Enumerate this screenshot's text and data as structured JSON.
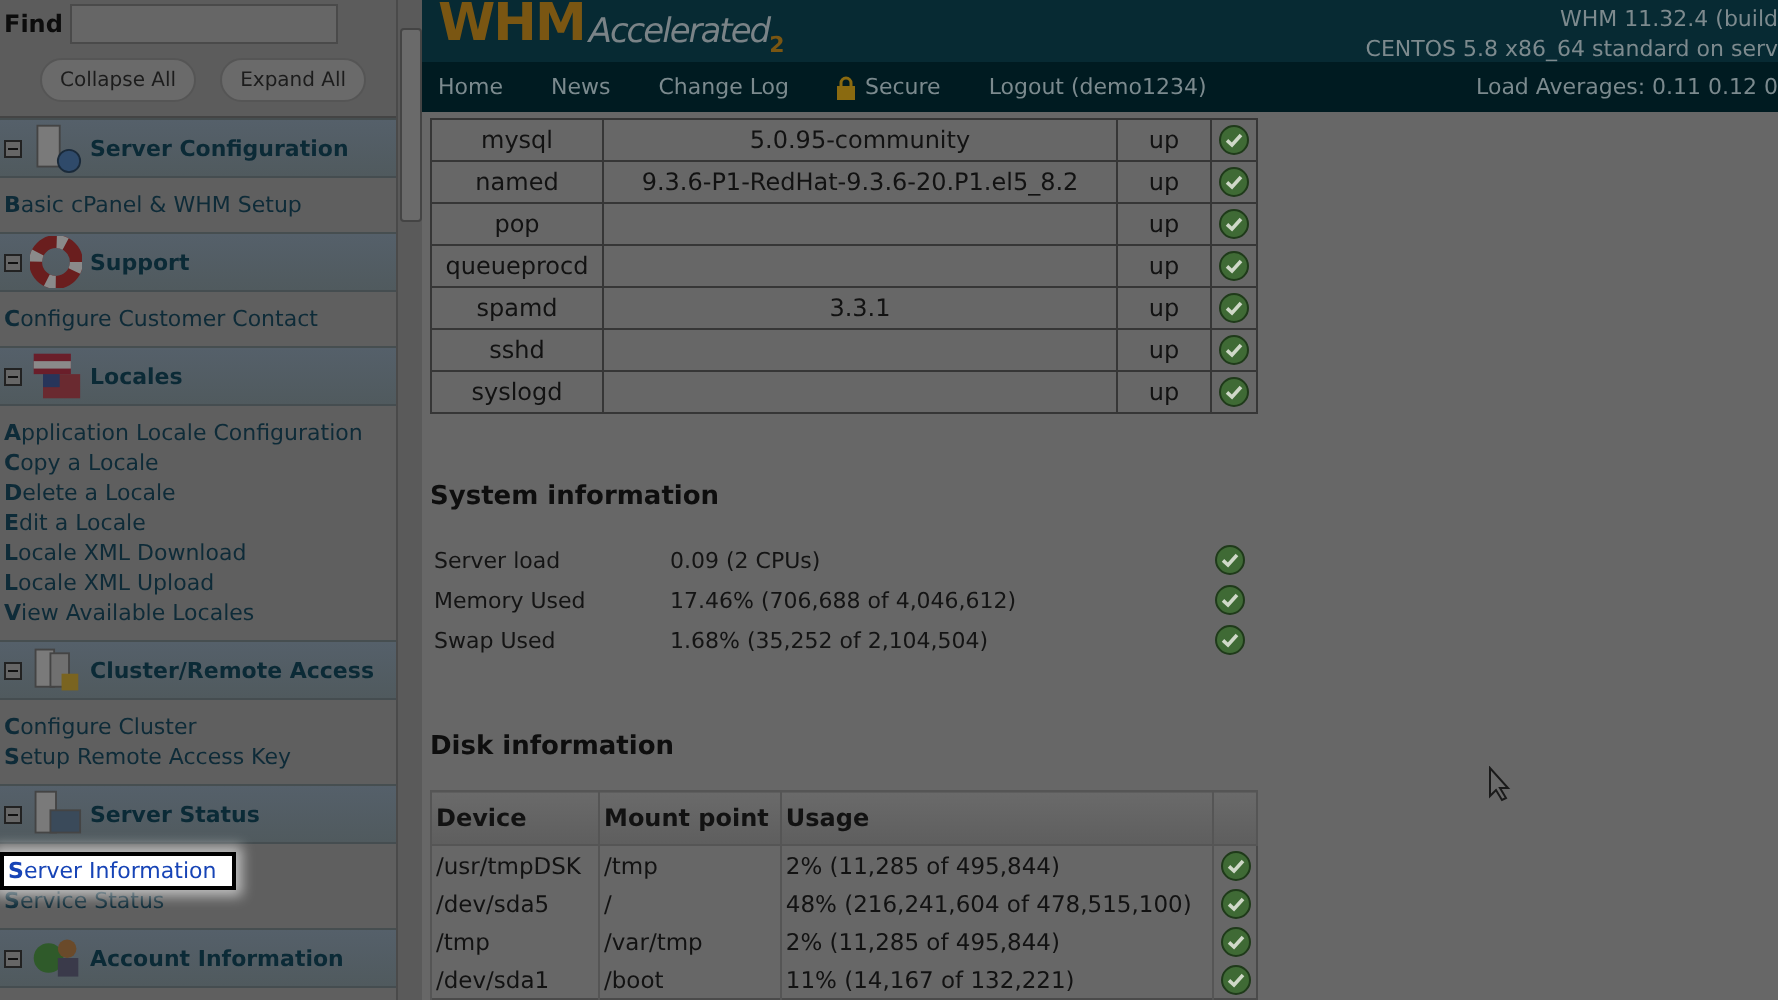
{
  "sidebar": {
    "find": {
      "label": "Find"
    },
    "buttons": [
      "Collapse All",
      "Expand All"
    ],
    "groups": [
      {
        "title": "Server Configuration",
        "expanded": true,
        "items": [
          {
            "label": "Basic cPanel & WHM Setup",
            "selected": false
          }
        ]
      },
      {
        "title": "Support",
        "expanded": true,
        "items": [
          {
            "label": "Configure Customer Contact",
            "selected": false
          }
        ]
      },
      {
        "title": "Locales",
        "expanded": true,
        "items": [
          {
            "label": "Application Locale Configuration",
            "selected": false
          },
          {
            "label": "Copy a Locale",
            "selected": false
          },
          {
            "label": "Delete a Locale",
            "selected": false
          },
          {
            "label": "Edit a Locale",
            "selected": false
          },
          {
            "label": "Locale XML Download",
            "selected": false
          },
          {
            "label": "Locale XML Upload",
            "selected": false
          },
          {
            "label": "View Available Locales",
            "selected": false
          }
        ]
      },
      {
        "title": "Cluster/Remote Access",
        "expanded": true,
        "items": [
          {
            "label": "Configure Cluster",
            "selected": false
          },
          {
            "label": "Setup Remote Access Key",
            "selected": false
          }
        ]
      },
      {
        "title": "Server Status",
        "expanded": true,
        "items": [
          {
            "label": "Server Information",
            "selected": true
          },
          {
            "label": "Service Status",
            "selected": false
          }
        ]
      },
      {
        "title": "Account Information",
        "expanded": true
      }
    ]
  },
  "header": {
    "logo": "WHM",
    "logo_sub": "Accelerated",
    "logo_mark": "2",
    "version": "WHM 11.32.4 (build",
    "os": "CENTOS 5.8 x86_64 standard on serv",
    "nav": [
      "Home",
      "News",
      "Change Log",
      "Secure",
      "Logout (demo1234)"
    ],
    "load": "Load Averages: 0.11 0.12 0"
  },
  "services": [
    {
      "name": "mysql",
      "version": "5.0.95-community",
      "status": "up",
      "ok": true
    },
    {
      "name": "named",
      "version": "9.3.6-P1-RedHat-9.3.6-20.P1.el5_8.2",
      "status": "up",
      "ok": true
    },
    {
      "name": "pop",
      "status": "up",
      "ok": true
    },
    {
      "name": "queueprocd",
      "status": "up",
      "ok": true
    },
    {
      "name": "spamd",
      "version": "3.3.1",
      "status": "up",
      "ok": true
    },
    {
      "name": "sshd",
      "status": "up",
      "ok": true
    },
    {
      "name": "syslogd",
      "status": "up",
      "ok": true
    }
  ],
  "system": {
    "title": "System information",
    "rows": [
      {
        "label": "Server load",
        "value": "0.09 (2 CPUs)",
        "ok": true
      },
      {
        "label": "Memory Used",
        "value": "17.46% (706,688 of 4,046,612)",
        "ok": true
      },
      {
        "label": "Swap Used",
        "value": "1.68% (35,252 of 2,104,504)",
        "ok": true
      }
    ]
  },
  "disk": {
    "title": "Disk information",
    "columns": [
      "Device",
      "Mount point",
      "Usage"
    ],
    "rows": [
      {
        "device": "/usr/tmpDSK",
        "mount": "/tmp",
        "usage": "2% (11,285 of 495,844)",
        "ok": true
      },
      {
        "device": "/dev/sda5",
        "mount": "/",
        "usage": "48% (216,241,604 of 478,515,100)",
        "ok": true
      },
      {
        "device": "/tmp",
        "mount": "/var/tmp",
        "usage": "2% (11,285 of 495,844)",
        "ok": true
      },
      {
        "device": "/dev/sda1",
        "mount": "/boot",
        "usage": "11% (14,167 of 132,221)",
        "ok": true
      }
    ]
  }
}
